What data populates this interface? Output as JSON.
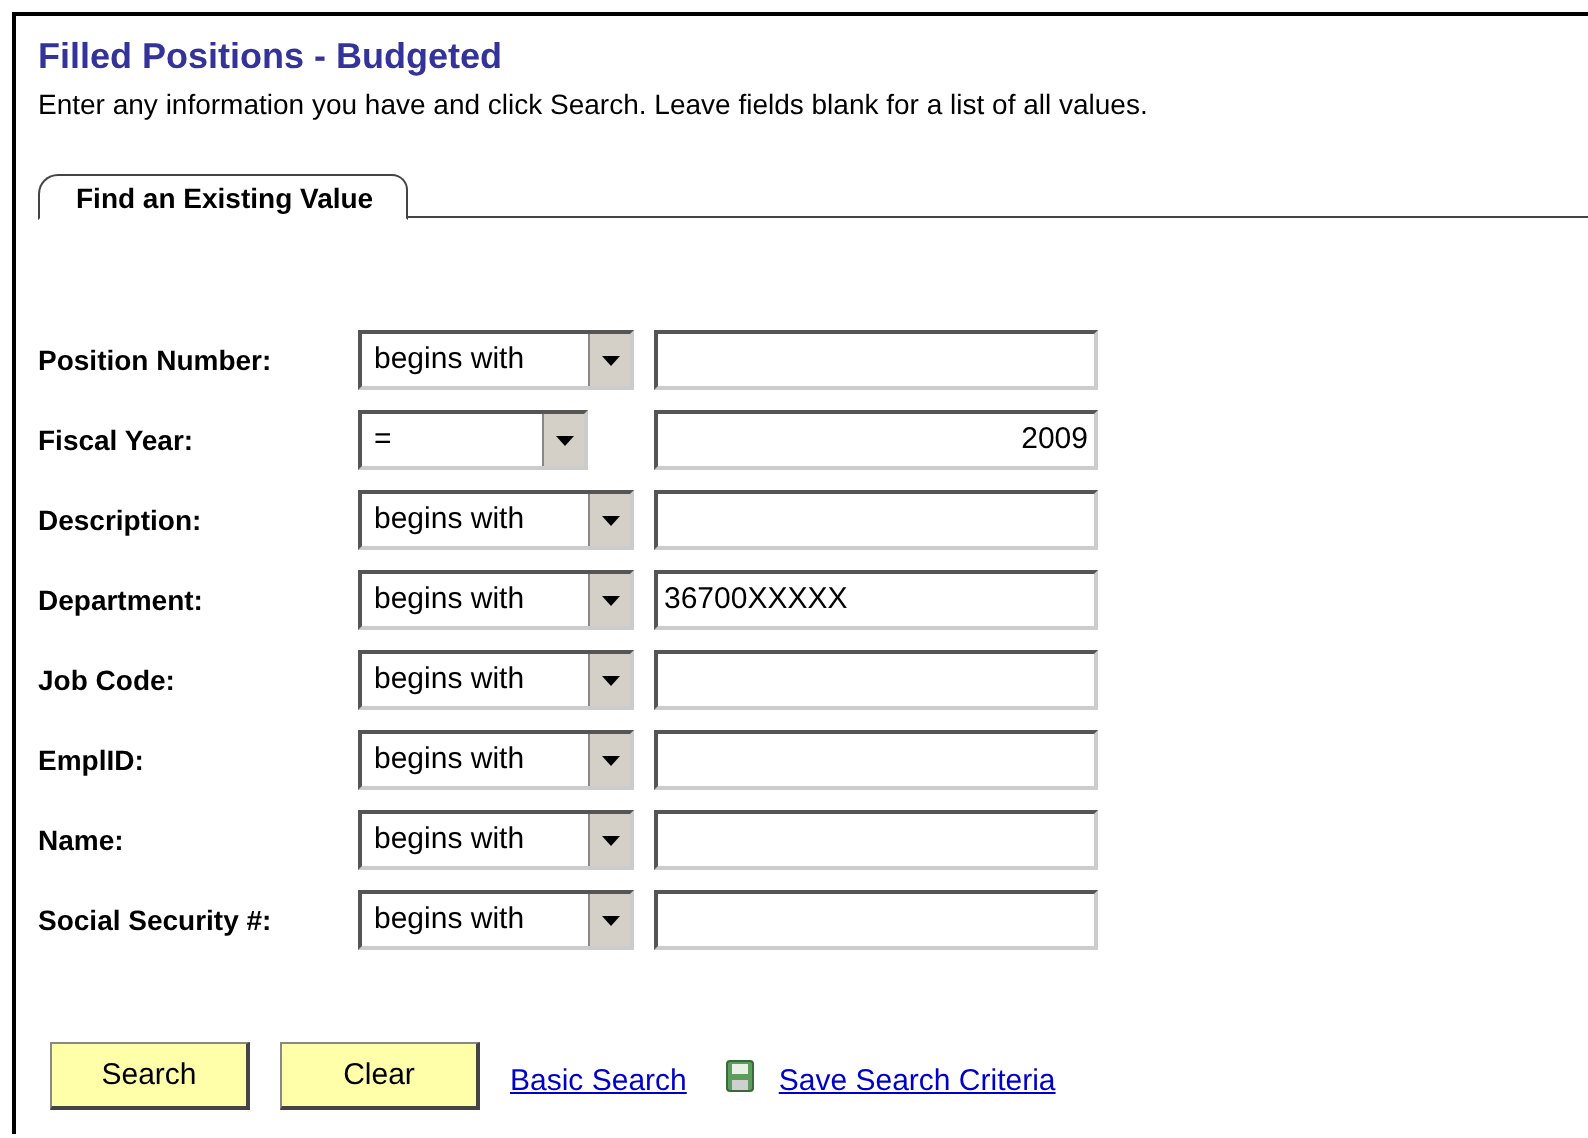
{
  "title": "Filled Positions - Budgeted",
  "instructions": "Enter any information you have and click Search. Leave fields blank for a list of all values.",
  "tabs": [
    {
      "label": "Find an Existing Value",
      "selected": true
    }
  ],
  "fields": [
    {
      "label": "Position Number:",
      "operator": "begins with",
      "kind": "text"
    },
    {
      "label": "Fiscal Year:",
      "operator": "=",
      "value": "2009",
      "kind": "number"
    },
    {
      "label": "Description:",
      "operator": "begins with",
      "kind": "text"
    },
    {
      "label": "Department:",
      "operator": "begins with",
      "value": "36700XXXXX",
      "kind": "text"
    },
    {
      "label": "Job Code:",
      "operator": "begins with",
      "kind": "text"
    },
    {
      "label": "EmplID:",
      "operator": "begins with",
      "kind": "text"
    },
    {
      "label": "Name:",
      "operator": "begins with",
      "kind": "text"
    },
    {
      "label": "Social Security #:",
      "operator": "begins with",
      "kind": "text"
    }
  ],
  "buttons": [
    "Search",
    "Clear"
  ],
  "links": [
    {
      "label": "Basic Search",
      "kind": "plain"
    },
    {
      "label": "Save Search Criteria",
      "kind": "save"
    }
  ]
}
